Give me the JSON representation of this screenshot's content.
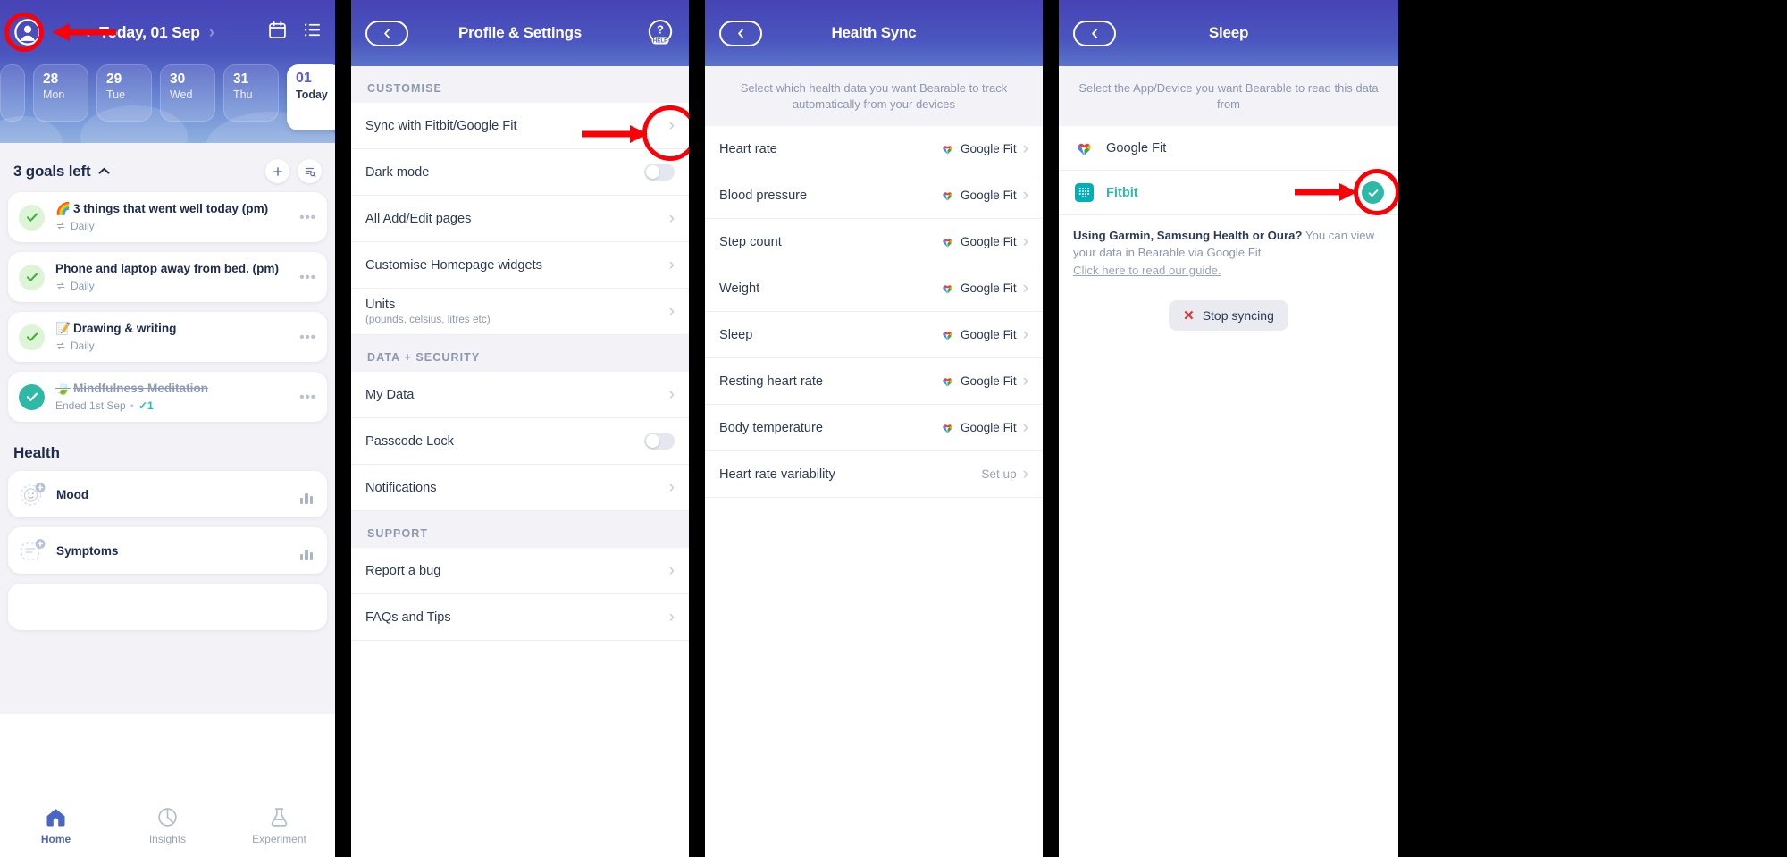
{
  "panel1": {
    "header": {
      "avatar_icon": "account-circle-icon",
      "prev_label": "‹",
      "date_title": "Today, 01 Sep",
      "next_label": "›",
      "calendar_icon": "calendar-icon",
      "list_icon": "list-icon"
    },
    "days": [
      {
        "num": "28",
        "label": "Mon",
        "today": false
      },
      {
        "num": "29",
        "label": "Tue",
        "today": false
      },
      {
        "num": "30",
        "label": "Wed",
        "today": false
      },
      {
        "num": "31",
        "label": "Thu",
        "today": false
      },
      {
        "num": "01",
        "label": "Today",
        "today": true
      }
    ],
    "goals_section": {
      "title": "3 goals left",
      "collapse_icon": "chevron-up-icon",
      "add_icon": "plus-icon",
      "filter_icon": "list-search-icon"
    },
    "goals": [
      {
        "emoji": "🌈",
        "title": "3 things that went well today (pm)",
        "sub": "Daily",
        "state": "light",
        "menu": "•••"
      },
      {
        "emoji": "",
        "title": "Phone and laptop away from bed. (pm)",
        "sub": "Daily",
        "state": "light",
        "menu": "•••"
      },
      {
        "emoji": "📝",
        "title": "Drawing & writing",
        "sub": "Daily",
        "state": "light",
        "menu": "•••"
      },
      {
        "emoji": "🍃",
        "title": "Mindfulness Meditation",
        "sub": "Ended 1st Sep",
        "sub_count": "1",
        "state": "solid",
        "done": true,
        "menu": "•••"
      }
    ],
    "health_section": {
      "title": "Health"
    },
    "health_items": [
      {
        "name": "Mood",
        "icon": "mood-face-icon"
      },
      {
        "name": "Symptoms",
        "icon": "symptoms-icon"
      }
    ],
    "tabs": [
      {
        "label": "Home",
        "icon": "home-icon",
        "active": true
      },
      {
        "label": "Insights",
        "icon": "pie-chart-icon",
        "active": false
      },
      {
        "label": "Experiment",
        "icon": "flask-icon",
        "active": false
      }
    ]
  },
  "panel2": {
    "header": {
      "back_icon": "chevron-left-icon",
      "title": "Profile & Settings",
      "help_icon": "help-icon",
      "help_label": "HELP"
    },
    "sections": [
      {
        "label": "CUSTOMISE",
        "rows": [
          {
            "label": "Sync with Fitbit/Google Fit",
            "control": "chevron"
          },
          {
            "label": "Dark mode",
            "control": "toggle"
          },
          {
            "label": "All Add/Edit pages",
            "control": "chevron"
          },
          {
            "label": "Customise Homepage widgets",
            "control": "chevron"
          },
          {
            "label": "Units",
            "sub": "(pounds, celsius, litres etc)",
            "control": "chevron"
          }
        ]
      },
      {
        "label": "DATA + SECURITY",
        "rows": [
          {
            "label": "My Data",
            "control": "chevron"
          },
          {
            "label": "Passcode Lock",
            "control": "toggle"
          },
          {
            "label": "Notifications",
            "control": "chevron"
          }
        ]
      },
      {
        "label": "SUPPORT",
        "rows": [
          {
            "label": "Report a bug",
            "control": "chevron"
          },
          {
            "label": "FAQs and Tips",
            "control": "chevron"
          }
        ]
      }
    ]
  },
  "panel3": {
    "header": {
      "back_icon": "chevron-left-icon",
      "title": "Health Sync"
    },
    "note": "Select which health data you want Bearable to track automatically from your devices",
    "rows": [
      {
        "name": "Heart rate",
        "value": "Google Fit",
        "has_icon": true
      },
      {
        "name": "Blood pressure",
        "value": "Google Fit",
        "has_icon": true
      },
      {
        "name": "Step count",
        "value": "Google Fit",
        "has_icon": true
      },
      {
        "name": "Weight",
        "value": "Google Fit",
        "has_icon": true
      },
      {
        "name": "Sleep",
        "value": "Google Fit",
        "has_icon": true
      },
      {
        "name": "Resting heart rate",
        "value": "Google Fit",
        "has_icon": true
      },
      {
        "name": "Body temperature",
        "value": "Google Fit",
        "has_icon": true
      },
      {
        "name": "Heart rate variability",
        "value": "Set up",
        "has_icon": false
      }
    ]
  },
  "panel4": {
    "header": {
      "back_icon": "chevron-left-icon",
      "title": "Sleep"
    },
    "note": "Select the App/Device you want Bearable to read this data from",
    "devices": [
      {
        "name": "Google Fit",
        "icon": "google-fit-icon",
        "selected": false
      },
      {
        "name": "Fitbit",
        "icon": "fitbit-icon",
        "selected": true
      }
    ],
    "info_bold": "Using Garmin, Samsung Health or Oura?",
    "info_rest": " You can view your data in Bearable via Google Fit.",
    "info_link": "Click here to read our guide.",
    "stop_button": {
      "x": "✕",
      "label": "Stop syncing"
    }
  },
  "annotations": {
    "accent_color": "#fb0007",
    "items": [
      {
        "name": "highlight-avatar-ring",
        "shape": "ring"
      },
      {
        "name": "arrow-to-avatar",
        "shape": "arrow"
      },
      {
        "name": "highlight-sync-chevron-ring",
        "shape": "ring"
      },
      {
        "name": "arrow-to-sync-chevron",
        "shape": "arrow"
      },
      {
        "name": "highlight-fitbit-check-ring",
        "shape": "ring"
      },
      {
        "name": "arrow-to-fitbit-check",
        "shape": "arrow"
      }
    ]
  }
}
